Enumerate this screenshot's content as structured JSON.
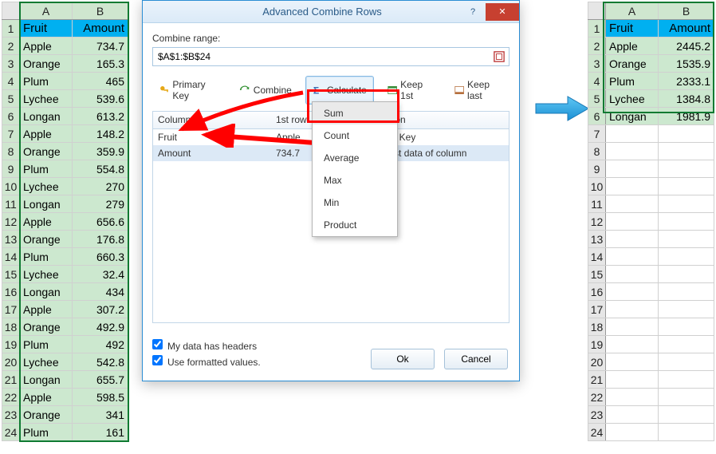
{
  "left_sheet": {
    "cols": [
      "A",
      "B"
    ],
    "header": {
      "a": "Fruit",
      "b": "Amount"
    },
    "rows": [
      {
        "n": "2",
        "a": "Apple",
        "b": "734.7"
      },
      {
        "n": "3",
        "a": "Orange",
        "b": "165.3"
      },
      {
        "n": "4",
        "a": "Plum",
        "b": "465"
      },
      {
        "n": "5",
        "a": "Lychee",
        "b": "539.6"
      },
      {
        "n": "6",
        "a": "Longan",
        "b": "613.2"
      },
      {
        "n": "7",
        "a": "Apple",
        "b": "148.2"
      },
      {
        "n": "8",
        "a": "Orange",
        "b": "359.9"
      },
      {
        "n": "9",
        "a": "Plum",
        "b": "554.8"
      },
      {
        "n": "10",
        "a": "Lychee",
        "b": "270"
      },
      {
        "n": "11",
        "a": "Longan",
        "b": "279"
      },
      {
        "n": "12",
        "a": "Apple",
        "b": "656.6"
      },
      {
        "n": "13",
        "a": "Orange",
        "b": "176.8"
      },
      {
        "n": "14",
        "a": "Plum",
        "b": "660.3"
      },
      {
        "n": "15",
        "a": "Lychee",
        "b": "32.4"
      },
      {
        "n": "16",
        "a": "Longan",
        "b": "434"
      },
      {
        "n": "17",
        "a": "Apple",
        "b": "307.2"
      },
      {
        "n": "18",
        "a": "Orange",
        "b": "492.9"
      },
      {
        "n": "19",
        "a": "Plum",
        "b": "492"
      },
      {
        "n": "20",
        "a": "Lychee",
        "b": "542.8"
      },
      {
        "n": "21",
        "a": "Longan",
        "b": "655.7"
      },
      {
        "n": "22",
        "a": "Apple",
        "b": "598.5"
      },
      {
        "n": "23",
        "a": "Orange",
        "b": "341"
      },
      {
        "n": "24",
        "a": "Plum",
        "b": "161"
      }
    ]
  },
  "right_sheet": {
    "cols": [
      "A",
      "B"
    ],
    "header": {
      "a": "Fruit",
      "b": "Amount"
    },
    "rows": [
      {
        "n": "2",
        "a": "Apple",
        "b": "2445.2"
      },
      {
        "n": "3",
        "a": "Orange",
        "b": "1535.9"
      },
      {
        "n": "4",
        "a": "Plum",
        "b": "2333.1"
      },
      {
        "n": "5",
        "a": "Lychee",
        "b": "1384.8"
      },
      {
        "n": "6",
        "a": "Longan",
        "b": "1981.9"
      }
    ],
    "empty_rows": [
      "7",
      "8",
      "9",
      "10",
      "11",
      "12",
      "13",
      "14",
      "15",
      "16",
      "17",
      "18",
      "19",
      "20",
      "21",
      "22",
      "23",
      "24"
    ]
  },
  "dialog": {
    "title": "Advanced Combine Rows",
    "help": "?",
    "close": "✕",
    "combine_label": "Combine range:",
    "range": "$A$1:$B$24",
    "buttons": {
      "primary": "Primary Key",
      "combine": "Combine",
      "calculate": "Calculate",
      "keep1st": "Keep 1st",
      "keeplast": "Keep last"
    },
    "grid_headers": {
      "c1": "Column",
      "c2": "1st row",
      "c3": "Operation"
    },
    "grid_rows": [
      {
        "c1": "Fruit",
        "c2": "Apple",
        "c3": "Primary Key"
      },
      {
        "c1": "Amount",
        "c2": "734.7",
        "c3": "Keep 1st data of column"
      }
    ],
    "dropdown": [
      "Sum",
      "Count",
      "Average",
      "Max",
      "Min",
      "Product"
    ],
    "check1": "My data has headers",
    "check2": "Use formatted values.",
    "ok": "Ok",
    "cancel": "Cancel"
  }
}
